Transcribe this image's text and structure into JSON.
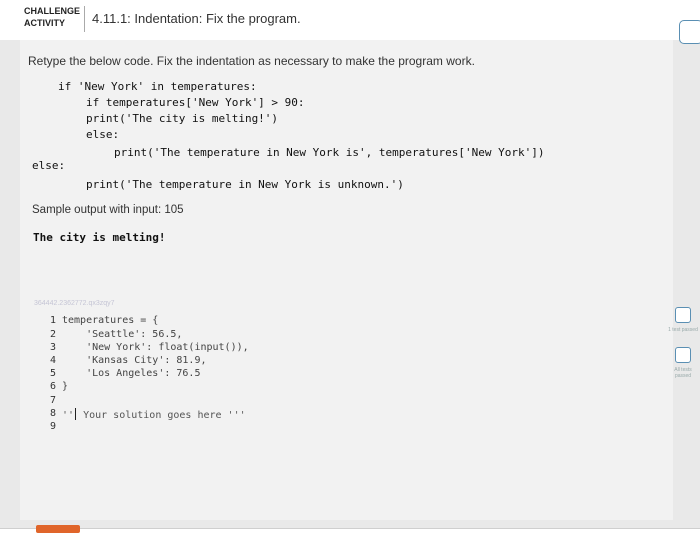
{
  "header": {
    "badge_line1": "CHALLENGE",
    "badge_line2": "ACTIVITY",
    "title": "4.11.1: Indentation: Fix the program."
  },
  "instruction": "Retype the below code. Fix the indentation as necessary to make the program work.",
  "given_code": {
    "line1": "if 'New York' in temperatures:",
    "line2": "if temperatures['New York'] > 90:",
    "line3": "print('The city is melting!')",
    "line4": "else:",
    "line5": "print('The temperature in New York is', temperatures['New York'])",
    "line6": "else:",
    "line7": "print('The temperature in New York is unknown.')"
  },
  "sample": {
    "label": "Sample output with input: 105",
    "output": "The city is melting!"
  },
  "faded_id": "364442.2362772.qx3zqy7",
  "editor": {
    "line_numbers": [
      "1",
      "2",
      "3",
      "4",
      "5",
      "6",
      "7",
      "8",
      "9"
    ],
    "lines": [
      "temperatures = {",
      "    'Seattle': 56.5,",
      "    'New York': float(input()),",
      "    'Kansas City': 81.9,",
      "    'Los Angeles': 76.5",
      "}",
      "",
      "",
      ""
    ],
    "comment_open": "''",
    "comment_text": " Your solution goes here '''"
  },
  "checks": {
    "test1_label": "1 test passed",
    "all_label": "All tests passed"
  },
  "colors": {
    "run_button": "#e0652a",
    "check_border": "#5a8fb3"
  }
}
